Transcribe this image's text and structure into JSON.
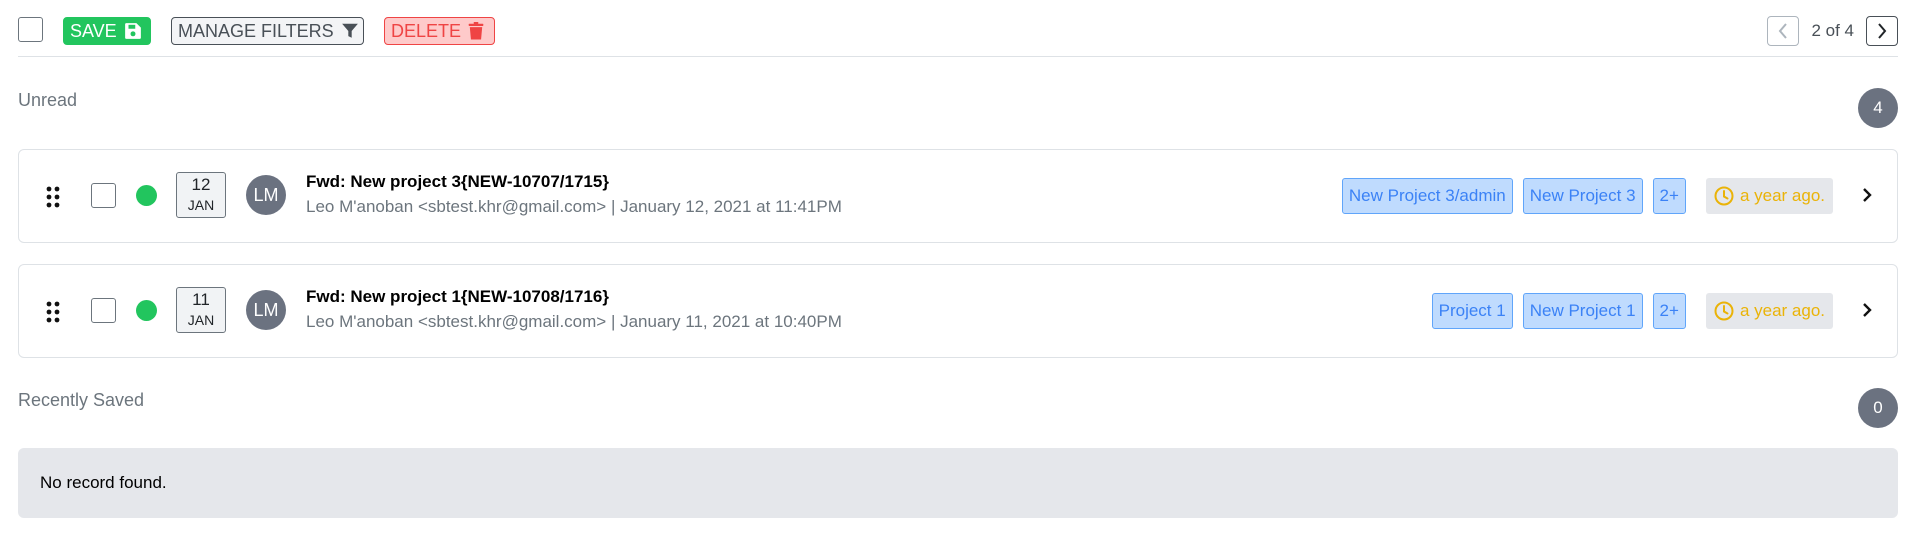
{
  "toolbar": {
    "save_label": "SAVE",
    "filters_label": "MANAGE FILTERS",
    "delete_label": "DELETE",
    "pagination": "2 of 4"
  },
  "sections": {
    "unread": {
      "title": "Unread",
      "count": "4"
    },
    "recent": {
      "title": "Recently Saved",
      "count": "0",
      "empty_text": "No record found."
    }
  },
  "emails": [
    {
      "day": "12",
      "month": "JAN",
      "initials": "LM",
      "subject": "Fwd: New project 3{NEW-10707/1715}",
      "meta": "Leo M'anoban <sbtest.khr@gmail.com> | January 12, 2021 at 11:41PM",
      "tags": [
        "New Project 3/admin",
        "New Project 3",
        "2+"
      ],
      "time": "a year ago."
    },
    {
      "day": "11",
      "month": "JAN",
      "initials": "LM",
      "subject": "Fwd: New project 1{NEW-10708/1716}",
      "meta": "Leo M'anoban <sbtest.khr@gmail.com> | January 11, 2021 at 10:40PM",
      "tags": [
        "Project 1",
        "New Project 1",
        "2+"
      ],
      "time": "a year ago."
    }
  ],
  "colors": {
    "save": "#22c55e",
    "delete": "#ef4444",
    "tag_bg": "#bfdbfe",
    "tag_text": "#3b82f6",
    "time": "#eab308",
    "unread_dot": "#22c55e",
    "badge": "#6b7280"
  },
  "icons": {
    "save": "floppy-disk-icon",
    "filters": "funnel-icon",
    "delete": "trash-icon",
    "pager_prev": "chevron-left-icon",
    "pager_next": "chevron-right-icon",
    "drag": "drag-handle-icon",
    "clock": "clock-icon",
    "open": "chevron-right-icon"
  }
}
